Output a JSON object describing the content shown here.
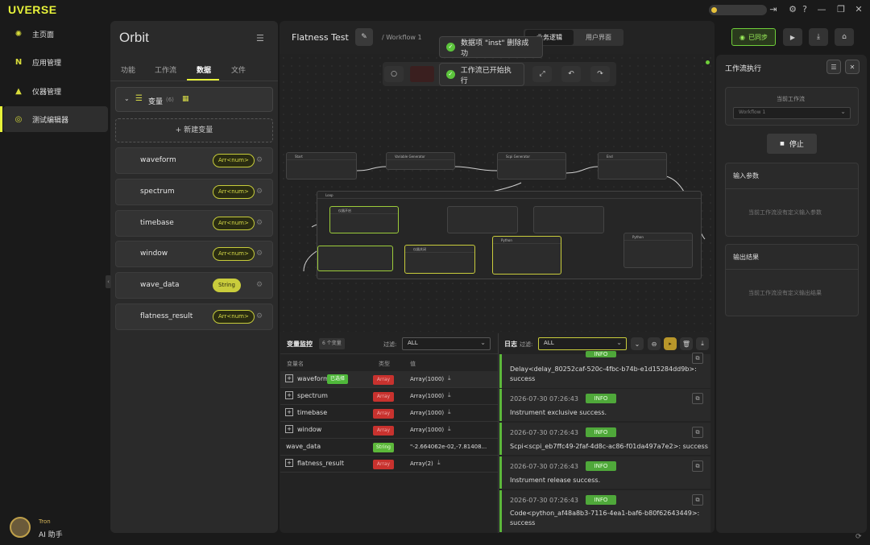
{
  "app": {
    "logo": "UVERSE"
  },
  "nav": {
    "items": [
      {
        "label": "主页面"
      },
      {
        "label": "应用管理"
      },
      {
        "label": "仪器管理"
      },
      {
        "label": "测试编辑器"
      }
    ],
    "assistant": {
      "name": "Tron",
      "label": "AI 助手"
    }
  },
  "sidebar": {
    "title": "Orbit",
    "tabs": [
      "功能",
      "工作流",
      "数据",
      "文件"
    ],
    "active_tab": "数据",
    "group": {
      "label": "变量",
      "count": "(6)"
    },
    "new_button": "+ 新建变量",
    "variables": [
      {
        "name": "waveform",
        "type": "Arr<num>"
      },
      {
        "name": "spectrum",
        "type": "Arr<num>"
      },
      {
        "name": "timebase",
        "type": "Arr<num>"
      },
      {
        "name": "window",
        "type": "Arr<num>"
      },
      {
        "name": "wave_data",
        "type": "String"
      },
      {
        "name": "flatness_result",
        "type": "Arr<num>"
      }
    ]
  },
  "header": {
    "title": "Flatness Test",
    "breadcrumb": "/ Workflow 1",
    "view_tabs": [
      "业务逻辑",
      "用户界面"
    ],
    "sync_label": "已同步"
  },
  "toasts": [
    {
      "text": "数据项 \"inst\" 删除成功"
    },
    {
      "text": "工作流已开始执行"
    }
  ],
  "workflow_nodes": {
    "start": "Start",
    "variable_generator": "Variable Generator",
    "scpi_generator": "Scpi Generator",
    "end": "End",
    "loop": "Loop",
    "instrument_open": "仪器开启",
    "instrument_close": "仪器关闭",
    "python": "Python"
  },
  "exec_panel": {
    "title": "工作流执行",
    "current_label": "当前工作流",
    "current_value": "Workflow 1",
    "stop_button": "停止",
    "input_title": "输入参数",
    "input_empty": "当前工作流没有定义输入参数",
    "output_title": "输出结果",
    "output_empty": "当前工作流没有定义输出结果"
  },
  "monitor": {
    "title": "变量监控",
    "count": "6 个变量",
    "filter_label": "过滤:",
    "filter_value": "ALL",
    "columns": [
      "变量名",
      "类型",
      "值"
    ],
    "rows": [
      {
        "name": "waveform",
        "tag": "已选择",
        "type": "Array",
        "value": "Array(1000)"
      },
      {
        "name": "spectrum",
        "type": "Array",
        "value": "Array(1000)"
      },
      {
        "name": "timebase",
        "type": "Array",
        "value": "Array(1000)"
      },
      {
        "name": "window",
        "type": "Array",
        "value": "Array(1000)"
      },
      {
        "name": "wave_data",
        "type": "String",
        "value": "\"-2.664062e-02,-7.81408..."
      },
      {
        "name": "flatness_result",
        "type": "Array",
        "value": "Array(2)"
      }
    ]
  },
  "logs": {
    "title": "日志",
    "filter_label": "过滤:",
    "filter_value": "ALL",
    "entries": [
      {
        "time": "",
        "level": "INFO",
        "message": "Delay<delay_80252caf-520c-4fbc-b74b-e1d15284dd9b>: success"
      },
      {
        "time": "2026-07-30 07:26:43",
        "level": "INFO",
        "message": "Instrument exclusive success."
      },
      {
        "time": "2026-07-30 07:26:43",
        "level": "INFO",
        "message": "Scpi<scpi_eb7ffc49-2faf-4d8c-ac86-f01da497a7e2>: success"
      },
      {
        "time": "2026-07-30 07:26:43",
        "level": "INFO",
        "message": "Instrument release success."
      },
      {
        "time": "2026-07-30 07:26:43",
        "level": "INFO",
        "message": "Code<python_af48a8b3-7116-4ea1-baf6-b80f62643449>: success"
      }
    ]
  }
}
